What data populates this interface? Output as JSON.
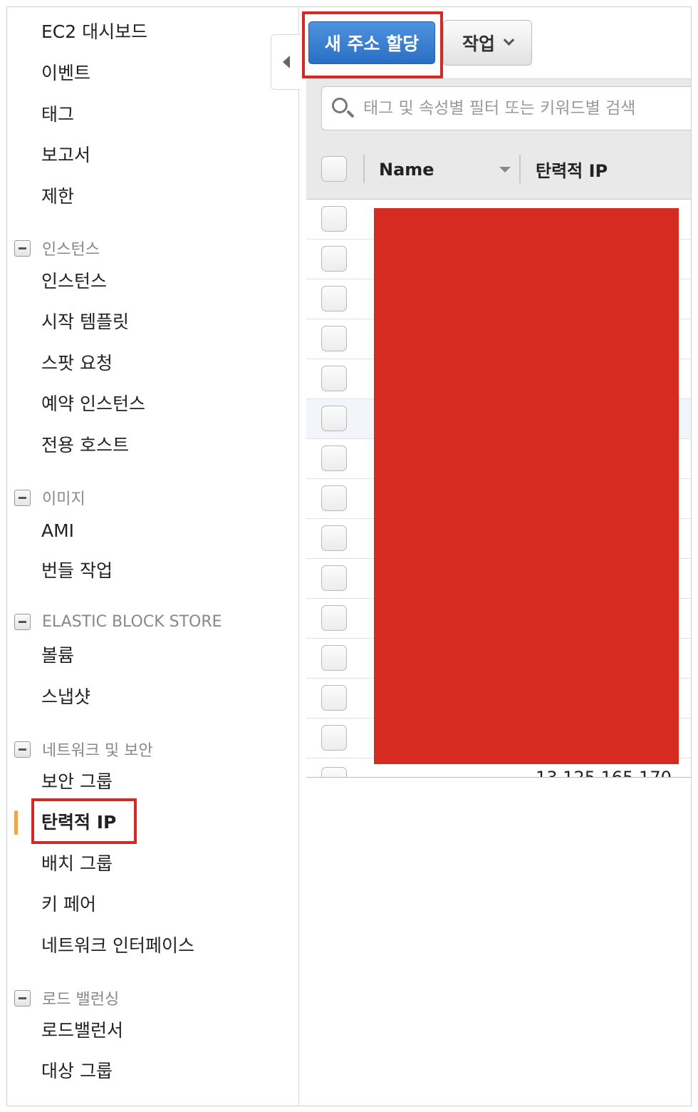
{
  "sidebar": {
    "top_items": [
      "EC2 대시보드",
      "이벤트",
      "태그",
      "보고서",
      "제한"
    ],
    "sections": [
      {
        "label": "인스턴스",
        "items": [
          "인스턴스",
          "시작 템플릿",
          "스팟 요청",
          "예약 인스턴스",
          "전용 호스트"
        ]
      },
      {
        "label": "이미지",
        "items": [
          "AMI",
          "번들 작업"
        ]
      },
      {
        "label": "ELASTIC BLOCK STORE",
        "items": [
          "볼륨",
          "스냅샷"
        ]
      },
      {
        "label": "네트워크 및 보안",
        "items": [
          "보안 그룹",
          "탄력적 IP",
          "배치 그룹",
          "키 페어",
          "네트워크 인터페이스"
        ]
      },
      {
        "label": "로드 밸런싱",
        "items": [
          "로드밸런서",
          "대상 그룹"
        ]
      }
    ],
    "active_item": "탄력적 IP"
  },
  "toolbar": {
    "allocate_label": "새 주소 할당",
    "actions_label": "작업"
  },
  "search": {
    "placeholder": "태그 및 속성별 필터 또는 키워드별 검색"
  },
  "table": {
    "columns": [
      "Name",
      "탄력적 IP"
    ],
    "partial_last_row_ip": "13.125.165.170"
  },
  "colors": {
    "primary_button": "#2b6fc4",
    "highlight": "#d22b25",
    "active_indicator": "#f0a348",
    "redaction": "#d52b21"
  }
}
